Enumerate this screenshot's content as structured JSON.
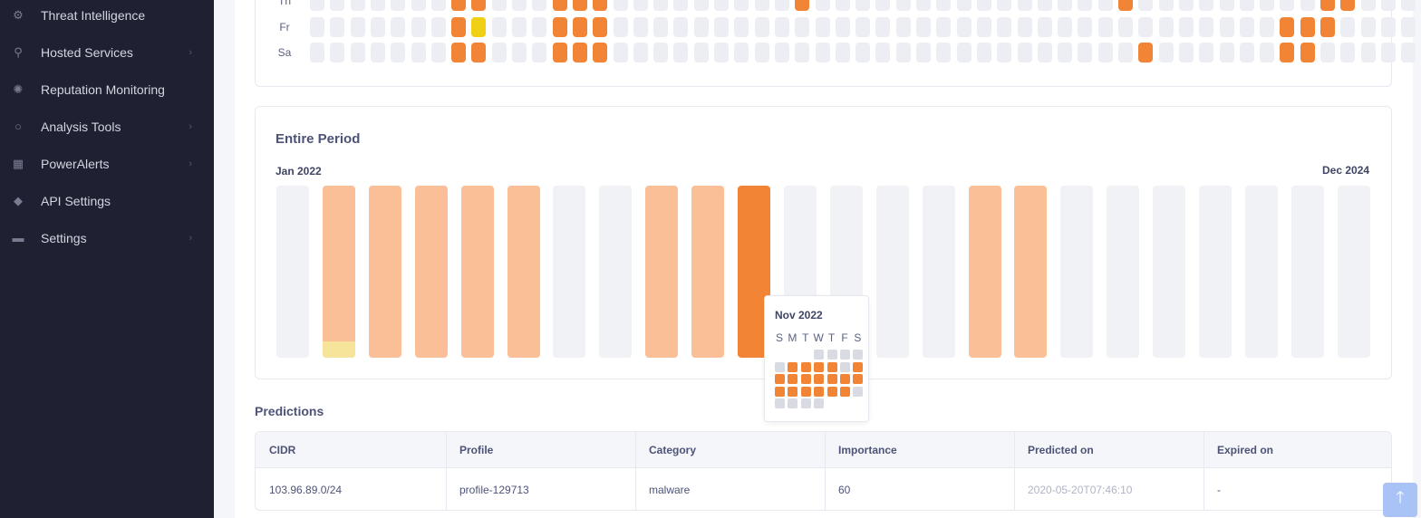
{
  "sidebar": {
    "items": [
      {
        "label": "Threat Intelligence",
        "icon": "gear-icon",
        "chevron": false
      },
      {
        "label": "Hosted Services",
        "icon": "network-icon",
        "chevron": true
      },
      {
        "label": "Reputation Monitoring",
        "icon": "badge-icon",
        "chevron": false
      },
      {
        "label": "Analysis Tools",
        "icon": "search-icon",
        "chevron": true
      },
      {
        "label": "PowerAlerts",
        "icon": "grid-icon",
        "chevron": true
      },
      {
        "label": "API Settings",
        "icon": "diamond-icon",
        "chevron": false
      },
      {
        "label": "Settings",
        "icon": "toggle-icon",
        "chevron": true
      }
    ]
  },
  "heatmap": {
    "day_labels": [
      "Th",
      "Fr",
      "Sa"
    ],
    "rows": [
      "0000000oo000ooo000000000o000000000000000o000000000oo000",
      "0000000oy000ooo000000000000000000000000000000000ooo0000",
      "0000000oo000ooo00000000000000000000000000o000000oo00000"
    ]
  },
  "entire_period": {
    "title": "Entire Period",
    "start_label": "Jan 2022",
    "end_label": "Dec 2024",
    "bars": [
      "e",
      "l",
      "l",
      "l",
      "l",
      "l",
      "e",
      "e",
      "l",
      "l",
      "d",
      "e",
      "e",
      "e",
      "e",
      "l",
      "l",
      "e",
      "e",
      "e",
      "e",
      "e",
      "e",
      "e"
    ],
    "bar_with_yellow": 1
  },
  "tooltip": {
    "title": "Nov 2022",
    "weekdays": [
      "S",
      "M",
      "T",
      "W",
      "T",
      "F",
      "S"
    ],
    "rows": [
      "...gggg",
      "goooogo",
      "ooooooo",
      "oooooog",
      "gggg..."
    ]
  },
  "predictions": {
    "title": "Predictions",
    "columns": [
      "CIDR",
      "Profile",
      "Category",
      "Importance",
      "Predicted on",
      "Expired on"
    ],
    "rows": [
      [
        "103.96.89.0/24",
        "profile-129713",
        "malware",
        "60",
        "2020-05-20T07:46:10",
        "-"
      ]
    ]
  },
  "scroll_top": {
    "icon": "arrow-up-icon",
    "glyph": "🡑"
  },
  "colors": {
    "sidebar_bg": "#1f2031",
    "accent_orange": "#f28535",
    "light_orange": "#fbbf98",
    "yellow": "#f0d014",
    "empty_cell": "#eceef3"
  }
}
